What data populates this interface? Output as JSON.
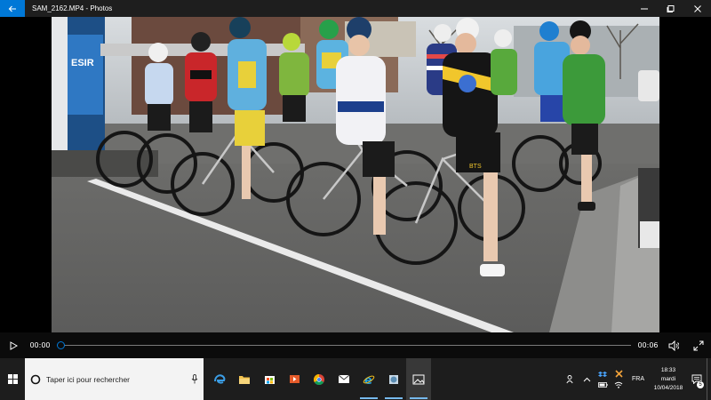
{
  "window": {
    "title": "SAM_2162.MP4 - Photos",
    "back_icon": "back-arrow-icon",
    "minimize_icon": "minimize-icon",
    "maximize_icon": "maximize-icon",
    "close_icon": "close-icon"
  },
  "video": {
    "description_icon": "video-frame",
    "jersey_texts": [
      "ESIR",
      "SAM",
      "BTS"
    ]
  },
  "player": {
    "play_icon": "play-icon",
    "current_time": "00:00",
    "total_time": "00:06",
    "progress": 0.0,
    "volume_icon": "volume-icon",
    "fullscreen_icon": "fullscreen-icon",
    "accent": "#0078d7"
  },
  "taskbar": {
    "search_placeholder": "Taper ici pour rechercher",
    "apps": [
      {
        "name": "edge",
        "icon": "edge-icon"
      },
      {
        "name": "file-explorer",
        "icon": "folder-icon"
      },
      {
        "name": "store",
        "icon": "store-icon"
      },
      {
        "name": "movies",
        "icon": "film-icon"
      },
      {
        "name": "chrome",
        "icon": "chrome-icon"
      },
      {
        "name": "mail",
        "icon": "mail-icon"
      },
      {
        "name": "internet-explorer",
        "icon": "ie-icon"
      },
      {
        "name": "app",
        "icon": "app-icon"
      },
      {
        "name": "photos",
        "icon": "photos-icon"
      }
    ],
    "tray": {
      "language": "FRA",
      "day": "mardi",
      "time": "18:33",
      "date": "10/04/2018",
      "notifications": "5"
    }
  }
}
